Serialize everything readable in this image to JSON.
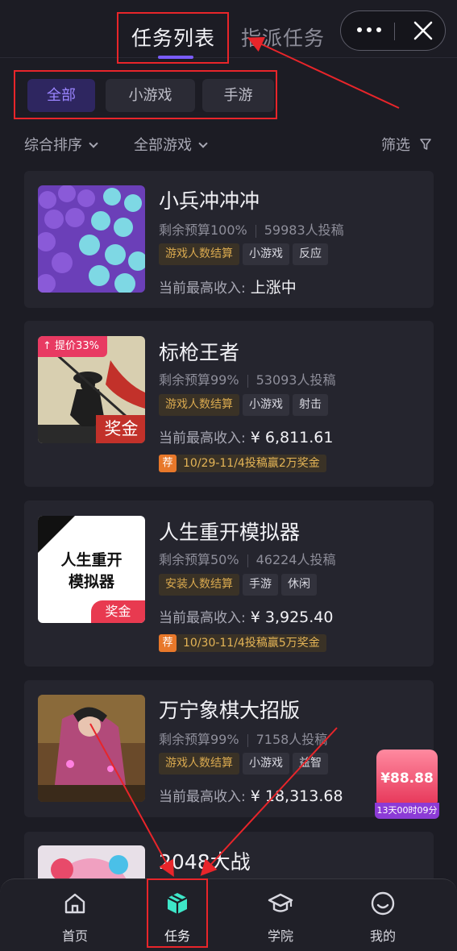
{
  "header": {
    "tabs": [
      {
        "label": "任务列表",
        "active": true
      },
      {
        "label": "指派任务",
        "active": false
      }
    ],
    "more_icon": "more-icon",
    "close_icon": "close-icon"
  },
  "chips": [
    {
      "label": "全部",
      "active": true
    },
    {
      "label": "小游戏",
      "active": false
    },
    {
      "label": "手游",
      "active": false
    }
  ],
  "filters": {
    "sort": "综合排序",
    "game": "全部游戏",
    "screen": "筛选"
  },
  "cards": [
    {
      "title": "小兵冲冲冲",
      "budget": "剩余预算100%",
      "submissions": "59983人投稿",
      "tags": [
        "游戏人数结算",
        "小游戏",
        "反应"
      ],
      "income_label": "当前最高收入:",
      "income_value": "上涨中",
      "promo_badge": "",
      "promo_text": ""
    },
    {
      "title": "标枪王者",
      "budget": "剩余预算99%",
      "submissions": "53093人投稿",
      "tags": [
        "游戏人数结算",
        "小游戏",
        "射击"
      ],
      "income_label": "当前最高收入:",
      "income_value": "¥ 6,811.61",
      "thumb_badge": "提价33%",
      "thumb_corner": "奖金",
      "promo_badge": "荐",
      "promo_text": "10/29-11/4投稿赢2万奖金"
    },
    {
      "title": "人生重开模拟器",
      "budget": "剩余预算50%",
      "submissions": "46224人投稿",
      "tags": [
        "安装人数结算",
        "手游",
        "休闲"
      ],
      "income_label": "当前最高收入:",
      "income_value": "¥ 3,925.40",
      "thumb_text": "人生重开模拟器",
      "thumb_corner": "奖金",
      "promo_badge": "荐",
      "promo_text": "10/30-11/4投稿赢5万奖金"
    },
    {
      "title": "万宁象棋大招版",
      "budget": "剩余预算99%",
      "submissions": "7158人投稿",
      "tags": [
        "游戏人数结算",
        "小游戏",
        "益智"
      ],
      "income_label": "当前最高收入:",
      "income_value": "¥ 18,313.68",
      "promo_badge": "",
      "promo_text": ""
    },
    {
      "title": "2048大战"
    }
  ],
  "floater": {
    "amount": "¥88.88",
    "timer": "13天00时09分"
  },
  "nav": [
    {
      "label": "首页",
      "icon": "home-icon",
      "active": false
    },
    {
      "label": "任务",
      "icon": "task-box-icon",
      "active": true
    },
    {
      "label": "学院",
      "icon": "academy-cap-icon",
      "active": false
    },
    {
      "label": "我的",
      "icon": "smile-profile-icon",
      "active": false
    }
  ],
  "colors": {
    "accent": "#7a5cff",
    "task_icon": "#3ee6c8",
    "annotation": "#e8252a",
    "gold_tag": "#d9a94f",
    "promo_orange": "#e8782a"
  }
}
